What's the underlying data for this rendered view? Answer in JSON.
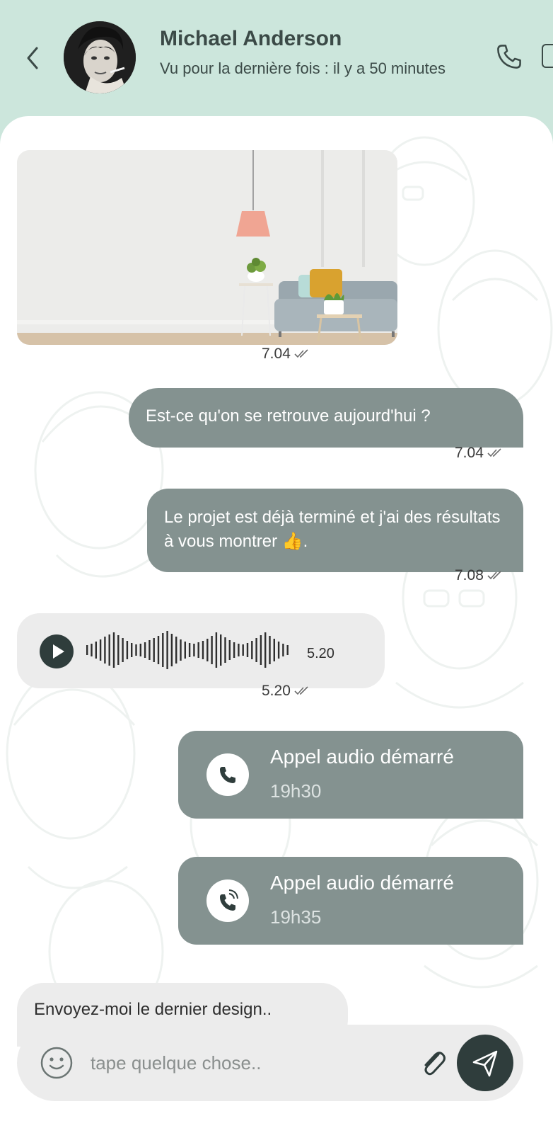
{
  "contact": {
    "name": "Michael Anderson",
    "status": "Vu pour la dernière fois : il y a 50 minutes"
  },
  "messages": [
    {
      "type": "image",
      "direction": "in",
      "time": "7.04"
    },
    {
      "type": "text",
      "direction": "out",
      "text": "Est-ce qu'on se retrouve aujourd'hui ?",
      "time": "7.04"
    },
    {
      "type": "text",
      "direction": "out",
      "text": "Le projet est déjà terminé et j'ai des résultats à vous montrer",
      "emoji": "👍",
      "trail": ".",
      "time": "7.08"
    },
    {
      "type": "voice",
      "direction": "in",
      "duration": "5.20",
      "time": "5.20"
    },
    {
      "type": "call",
      "direction": "out",
      "title": "Appel audio démarré",
      "time": "19h30",
      "icon": "phone-icon"
    },
    {
      "type": "call",
      "direction": "out",
      "title": "Appel audio démarré",
      "time": "19h35",
      "icon": "phone-ringing-icon"
    },
    {
      "type": "text",
      "direction": "in",
      "text": "Envoyez-moi le dernier design.."
    }
  ],
  "composer": {
    "placeholder": "tape quelque chose.."
  },
  "colors": {
    "header_bg": "#cce6dc",
    "outgoing_bubble": "#849290",
    "incoming_bubble": "#ececec",
    "send_button": "#2f3d3c"
  },
  "icons": [
    "back-icon",
    "phone-icon",
    "video-icon",
    "play-icon",
    "phone-ringing-icon",
    "emoji-icon",
    "paperclip-icon",
    "send-icon",
    "double-check-icon"
  ]
}
